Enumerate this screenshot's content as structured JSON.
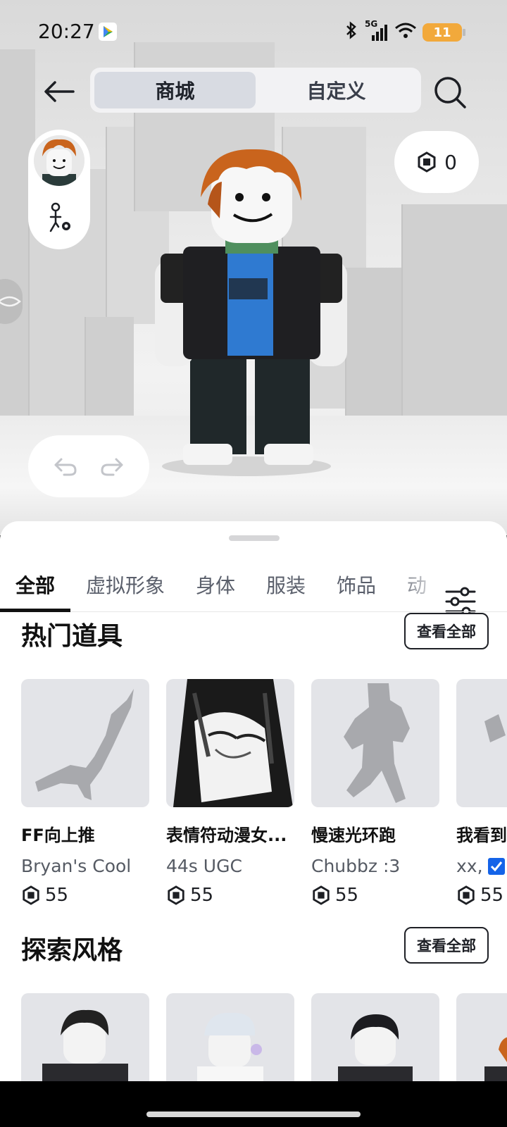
{
  "status_bar": {
    "time": "20:27",
    "network": "5G",
    "battery": "11"
  },
  "header": {
    "tabs": [
      {
        "label": "商城",
        "active": true
      },
      {
        "label": "自定义",
        "active": false
      }
    ]
  },
  "robux": {
    "balance": "0"
  },
  "categories": {
    "tabs": [
      "全部",
      "虚拟形象",
      "身体",
      "服装",
      "饰品",
      "动"
    ],
    "active_index": 0
  },
  "hot_items": {
    "title": "热门道具",
    "see_all": "查看全部",
    "items": [
      {
        "name": "FF向上推",
        "creator": "Bryan's Cool",
        "price": "55"
      },
      {
        "name": "表情符动漫女...",
        "creator": "44s UGC",
        "price": "55"
      },
      {
        "name": "慢速光环跑",
        "creator": "Chubbz :3",
        "price": "55"
      },
      {
        "name": "我看到",
        "creator": "xx,",
        "price": "55"
      }
    ]
  },
  "explore_styles": {
    "title": "探索风格",
    "see_all": "查看全部"
  },
  "colors": {
    "accent": "#1e2026",
    "card_bg": "#e3e4e8",
    "verified": "#1463e8",
    "battery": "#f2a93b"
  }
}
